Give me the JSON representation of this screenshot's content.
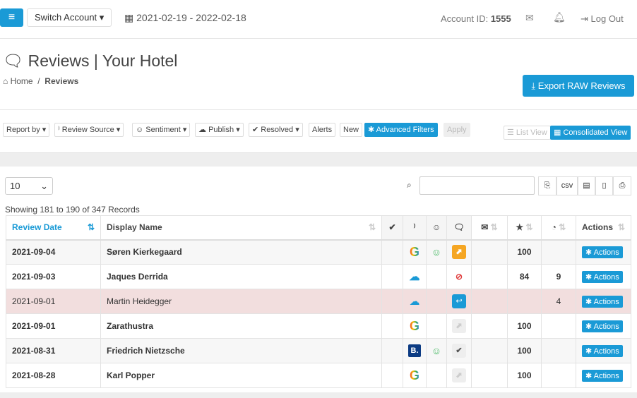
{
  "topbar": {
    "switch_account": "Switch Account ▾",
    "date_range": "2021-02-19 - 2022-02-18",
    "account_label": "Account ID:",
    "account_id": "1555",
    "logout": "Log Out"
  },
  "page": {
    "title": "Reviews | Your Hotel",
    "breadcrumb_home": "Home",
    "breadcrumb_current": "Reviews",
    "export": "Export RAW Reviews"
  },
  "filters": {
    "report_by": "Report by ▾",
    "review_source": "Review Source ▾",
    "sentiment": "Sentiment ▾",
    "publish": "Publish ▾",
    "resolved": "Resolved ▾",
    "alerts": "Alerts",
    "new": "New",
    "advanced": "Advanced Filters",
    "apply": "Apply",
    "list_view": "List View",
    "consolidated_view": "Consolidated View"
  },
  "table_controls": {
    "page_size": "10",
    "csv": "csv",
    "info": "Showing 181 to 190 of 347 Records"
  },
  "columns": {
    "review_date": "Review Date",
    "display_name": "Display Name",
    "actions": "Actions"
  },
  "rows": [
    {
      "date": "2021-09-04",
      "name": "Søren Kierkegaard",
      "source": "google",
      "sentiment": "positive",
      "comment": "open",
      "rating": "100",
      "score": "",
      "action": "Actions"
    },
    {
      "date": "2021-09-03",
      "name": "Jaques Derrida",
      "source": "tripadvisor",
      "sentiment": "",
      "comment": "blocked",
      "rating": "84",
      "score": "9",
      "action": "Actions"
    },
    {
      "date": "2021-09-01",
      "name": "Martin Heidegger",
      "source": "tripadvisor",
      "sentiment": "",
      "comment": "reply",
      "rating": "",
      "score": "4",
      "action": "Actions"
    },
    {
      "date": "2021-09-01",
      "name": "Zarathustra",
      "source": "google",
      "sentiment": "",
      "comment": "disabled",
      "rating": "100",
      "score": "",
      "action": "Actions"
    },
    {
      "date": "2021-08-31",
      "name": "Friedrich Nietzsche",
      "source": "booking",
      "sentiment": "positive",
      "comment": "resolved",
      "rating": "100",
      "score": "",
      "action": "Actions"
    },
    {
      "date": "2021-08-28",
      "name": "Karl Popper",
      "source": "google",
      "sentiment": "",
      "comment": "disabled",
      "rating": "100",
      "score": "",
      "action": "Actions"
    }
  ]
}
